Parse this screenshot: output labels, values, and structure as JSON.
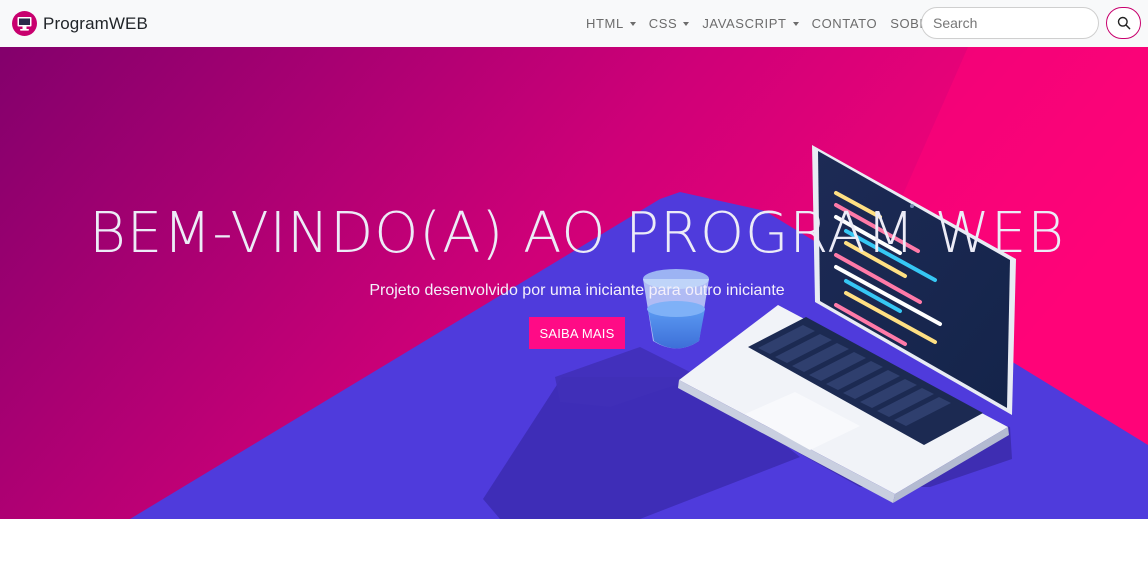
{
  "navbar": {
    "brand_name": "ProgramWEB",
    "brand_icon": "monitor-icon",
    "items": [
      {
        "label": "HTML",
        "dropdown": true
      },
      {
        "label": "CSS",
        "dropdown": true
      },
      {
        "label": "JAVASCRIPT",
        "dropdown": true
      },
      {
        "label": "CONTATO",
        "dropdown": false
      },
      {
        "label": "SOBRE",
        "dropdown": false
      }
    ],
    "search": {
      "placeholder": "Search",
      "value": "",
      "button_icon": "search-icon"
    }
  },
  "hero": {
    "title": "BEM-VINDO(A) AO PROGRAM WEB",
    "subtitle": "Projeto desenvolvido por uma iniciante para outro iniciante",
    "button_label": "SAIBA MAIS",
    "illustration": "laptop-and-glass-illustration"
  },
  "colors": {
    "accent": "#ff0b86",
    "gradient_start": "#83006c",
    "gradient_end": "#ff0478",
    "violet": "#4f3bdc",
    "navbar_bg": "#f8f9fa"
  }
}
